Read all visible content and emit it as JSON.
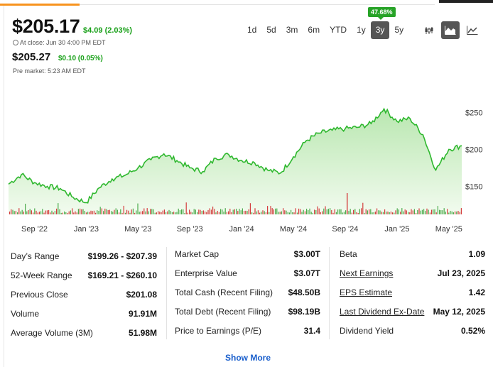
{
  "quote": {
    "price": "$205.17",
    "change": "$4.09 (2.03%)",
    "close_label": "At close: Jun 30 4:00 PM EDT",
    "pre_price": "$205.27",
    "pre_change": "$0.10 (0.05%)",
    "pre_label": "Pre market: 5:23 AM EDT"
  },
  "ranges": {
    "tabs": [
      "1d",
      "5d",
      "3m",
      "6m",
      "YTD",
      "1y",
      "3y",
      "5y"
    ],
    "selected": "3y",
    "gain_badge": "47.68%"
  },
  "chart_types": [
    {
      "icon": "candlestick-icon",
      "active": false
    },
    {
      "icon": "area-chart-icon",
      "active": true
    },
    {
      "icon": "line-chart-icon",
      "active": false
    }
  ],
  "colors": {
    "up": "#18a018",
    "line": "#2fb82f",
    "area_top": "#b9e7b0",
    "area_bottom": "#f2fbef",
    "selected_tab": "#555555",
    "link": "#1a5fcc",
    "volume_up": "#4cab4c",
    "volume_down": "#d43d3d"
  },
  "chart_data": {
    "type": "area",
    "x_ticks": [
      "Sep '22",
      "Jan '23",
      "May '23",
      "Sep '23",
      "Jan '24",
      "May '24",
      "Sep '24",
      "Jan '25",
      "May '25"
    ],
    "y_ticks": [
      "$250",
      "$200",
      "$150"
    ],
    "ylim": [
      112,
      262
    ],
    "start": "Jul '22",
    "end": "Jun 30 '25",
    "series": [
      {
        "date": "Jul '22",
        "value": 153
      },
      {
        "date": "Aug '22",
        "value": 166
      },
      {
        "date": "Sep '22",
        "value": 155
      },
      {
        "date": "Oct '22",
        "value": 150
      },
      {
        "date": "Nov '22",
        "value": 147
      },
      {
        "date": "Dec '22",
        "value": 135
      },
      {
        "date": "Jan '23",
        "value": 128
      },
      {
        "date": "Feb '23",
        "value": 148
      },
      {
        "date": "Mar '23",
        "value": 160
      },
      {
        "date": "Apr '23",
        "value": 165
      },
      {
        "date": "May '23",
        "value": 175
      },
      {
        "date": "Jun '23",
        "value": 186
      },
      {
        "date": "Jul '23",
        "value": 194
      },
      {
        "date": "Aug '23",
        "value": 185
      },
      {
        "date": "Sep '23",
        "value": 175
      },
      {
        "date": "Oct '23",
        "value": 170
      },
      {
        "date": "Nov '23",
        "value": 188
      },
      {
        "date": "Dec '23",
        "value": 193
      },
      {
        "date": "Jan '24",
        "value": 185
      },
      {
        "date": "Feb '24",
        "value": 182
      },
      {
        "date": "Mar '24",
        "value": 172
      },
      {
        "date": "Apr '24",
        "value": 168
      },
      {
        "date": "May '24",
        "value": 190
      },
      {
        "date": "Jun '24",
        "value": 212
      },
      {
        "date": "Jul '24",
        "value": 222
      },
      {
        "date": "Aug '24",
        "value": 226
      },
      {
        "date": "Sep '24",
        "value": 228
      },
      {
        "date": "Oct '24",
        "value": 230
      },
      {
        "date": "Nov '24",
        "value": 235
      },
      {
        "date": "Dec '24",
        "value": 255
      },
      {
        "date": "Jan '25",
        "value": 238
      },
      {
        "date": "Feb '25",
        "value": 242
      },
      {
        "date": "Mar '25",
        "value": 220
      },
      {
        "date": "Apr '25",
        "value": 172
      },
      {
        "date": "May '25",
        "value": 200
      },
      {
        "date": "Jun '25",
        "value": 205
      }
    ]
  },
  "stats": {
    "col1": [
      {
        "label": "Day’s Range",
        "value": "$199.26 - $207.39"
      },
      {
        "label": "52-Week Range",
        "value": "$169.21 - $260.10"
      },
      {
        "label": "Previous Close",
        "value": "$201.08"
      },
      {
        "label": "Volume",
        "value": "91.91M"
      },
      {
        "label": "Average Volume (3M)",
        "value": "51.98M"
      }
    ],
    "col2": [
      {
        "label": "Market Cap",
        "value": "$3.00T"
      },
      {
        "label": "Enterprise Value",
        "value": "$3.07T"
      },
      {
        "label": "Total Cash (Recent Filing)",
        "value": "$48.50B"
      },
      {
        "label": "Total Debt (Recent Filing)",
        "value": "$98.19B"
      },
      {
        "label": "Price to Earnings (P/E)",
        "value": "31.4"
      }
    ],
    "col3": [
      {
        "label": "Beta",
        "value": "1.09",
        "link": false
      },
      {
        "label": "Next Earnings",
        "value": "Jul 23, 2025",
        "link": true
      },
      {
        "label": "EPS Estimate",
        "value": "1.42",
        "link": true
      },
      {
        "label": "Last Dividend Ex-Date",
        "value": "May 12, 2025",
        "link": true
      },
      {
        "label": "Dividend Yield",
        "value": "0.52%",
        "link": false
      }
    ]
  },
  "show_more": "Show More"
}
